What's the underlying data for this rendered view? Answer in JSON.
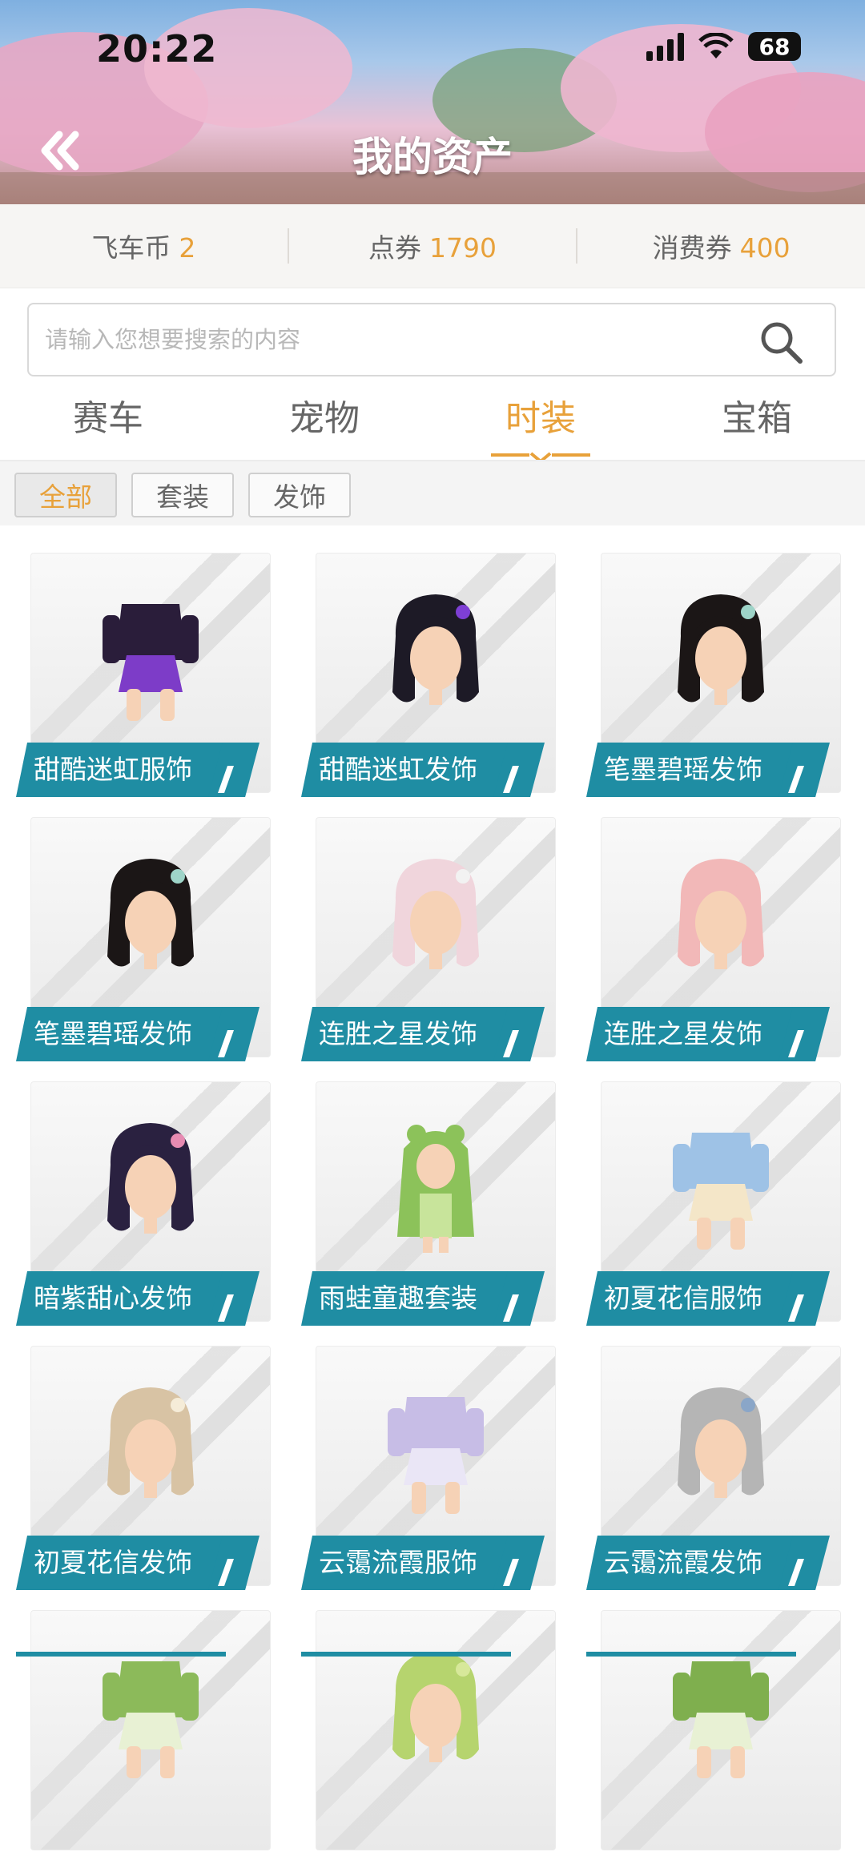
{
  "status_bar": {
    "time": "20:22",
    "battery": "68"
  },
  "header": {
    "title": "我的资产"
  },
  "currencies": [
    {
      "label": "飞车币",
      "value": "2"
    },
    {
      "label": "点券",
      "value": "1790"
    },
    {
      "label": "消费券",
      "value": "400"
    }
  ],
  "search": {
    "placeholder": "请输入您想要搜索的内容"
  },
  "tabs": [
    {
      "label": "赛车"
    },
    {
      "label": "宠物"
    },
    {
      "label": "时装",
      "active": true
    },
    {
      "label": "宝箱"
    }
  ],
  "filters": [
    {
      "label": "全部",
      "active": true
    },
    {
      "label": "套装"
    },
    {
      "label": "发饰"
    }
  ],
  "items": [
    {
      "name": "甜酷迷虹服饰",
      "hair": "#2a1d3a",
      "accent": "#7d3cc8",
      "kind": "outfit"
    },
    {
      "name": "甜酷迷虹发饰",
      "hair": "#1d1a26",
      "accent": "#7e3fd4",
      "kind": "hair"
    },
    {
      "name": "笔墨碧瑶发饰",
      "hair": "#1b1616",
      "accent": "#9ed4c8",
      "kind": "hair"
    },
    {
      "name": "笔墨碧瑶发饰",
      "hair": "#1b1616",
      "accent": "#9ed4c8",
      "kind": "hair"
    },
    {
      "name": "连胜之星发饰",
      "hair": "#f0d5dc",
      "accent": "#f2f2f2",
      "kind": "hair"
    },
    {
      "name": "连胜之星发饰",
      "hair": "#f2b8b8",
      "accent": "#f2b8b8",
      "kind": "hair"
    },
    {
      "name": "暗紫甜心发饰",
      "hair": "#2a2140",
      "accent": "#e78bb2",
      "kind": "hair"
    },
    {
      "name": "雨蛙童趣套装",
      "hair": "#8cc25a",
      "accent": "#c8e49b",
      "kind": "suit"
    },
    {
      "name": "初夏花信服饰",
      "hair": "#9ec2e6",
      "accent": "#f4e6c8",
      "kind": "outfit"
    },
    {
      "name": "初夏花信发饰",
      "hair": "#d8c3a4",
      "accent": "#f5ecd8",
      "kind": "hair"
    },
    {
      "name": "云霭流霞服饰",
      "hair": "#c7bde6",
      "accent": "#eae6f6",
      "kind": "outfit"
    },
    {
      "name": "云霭流霞发饰",
      "hair": "#b5b5b5",
      "accent": "#8aa6c8",
      "kind": "hair"
    },
    {
      "name": "",
      "hair": "#8cba5a",
      "accent": "#e8f1d4",
      "kind": "outfit"
    },
    {
      "name": "",
      "hair": "#b6d46e",
      "accent": "#d7e89a",
      "kind": "hair"
    },
    {
      "name": "",
      "hair": "#7faf4e",
      "accent": "#e8f1d4",
      "kind": "outfit"
    }
  ],
  "colors": {
    "accent": "#e8a13a",
    "label_bg": "#1f8da3"
  }
}
